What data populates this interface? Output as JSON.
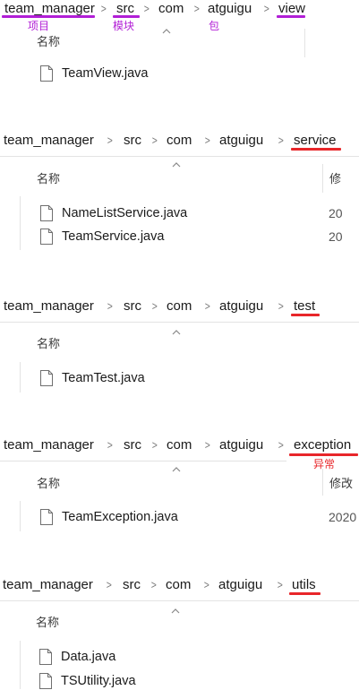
{
  "panels": [
    {
      "breadcrumb": [
        "team_manager",
        "src",
        "com",
        "atguigu",
        "view"
      ],
      "annotations": [
        "项目",
        "模块",
        "包"
      ],
      "name_header": "名称",
      "date_header": "",
      "files": [
        {
          "name": "TeamView.java",
          "date": ""
        }
      ]
    },
    {
      "breadcrumb": [
        "team_manager",
        "src",
        "com",
        "atguigu",
        "service"
      ],
      "annotations": [],
      "name_header": "名称",
      "date_header": "修",
      "files": [
        {
          "name": "NameListService.java",
          "date": "20"
        },
        {
          "name": "TeamService.java",
          "date": "20"
        }
      ]
    },
    {
      "breadcrumb": [
        "team_manager",
        "src",
        "com",
        "atguigu",
        "test"
      ],
      "annotations": [],
      "name_header": "名称",
      "date_header": "",
      "files": [
        {
          "name": "TeamTest.java",
          "date": ""
        }
      ]
    },
    {
      "breadcrumb": [
        "team_manager",
        "src",
        "com",
        "atguigu",
        "exception"
      ],
      "annotations": [
        "异常"
      ],
      "name_header": "名称",
      "date_header": "修改",
      "files": [
        {
          "name": "TeamException.java",
          "date": "2020"
        }
      ]
    },
    {
      "breadcrumb": [
        "team_manager",
        "src",
        "com",
        "atguigu",
        "utils"
      ],
      "annotations": [],
      "name_header": "名称",
      "date_header": "",
      "files": [
        {
          "name": "Data.java",
          "date": ""
        },
        {
          "name": "TSUtility.java",
          "date": ""
        }
      ]
    }
  ],
  "icons": {
    "separator": "chevron-right-icon",
    "sort": "sort-up-icon",
    "file": "java-file-icon"
  },
  "colors": {
    "annotation_purple": "#b21fd6",
    "annotation_red": "#e8262a",
    "divider": "#e3e3e3"
  }
}
